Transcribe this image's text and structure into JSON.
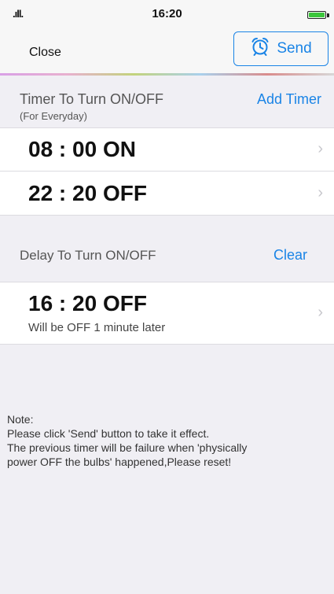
{
  "status": {
    "signal": ".ıll.",
    "time": "16:20",
    "battery_color": "#3cc63c"
  },
  "nav": {
    "close_label": "Close",
    "send_label": "Send",
    "send_icon": "alarm-clock-icon",
    "accent": "#1a84e6"
  },
  "timer_section": {
    "title": "Timer To Turn ON/OFF",
    "subtitle": "(For Everyday)",
    "add_label": "Add Timer",
    "rows": [
      {
        "time": "08 : 00  ON"
      },
      {
        "time": "22 : 20  OFF"
      }
    ]
  },
  "delay_section": {
    "title": "Delay To Turn ON/OFF",
    "clear_label": "Clear",
    "row": {
      "time": "16 : 20  OFF",
      "subtitle": "Will be OFF 1 minute later"
    }
  },
  "note": {
    "lines": [
      "Note:",
      "Please click 'Send' button to take it effect.",
      "The previous timer will be failure when 'physically",
      "power OFF the bulbs' happened,Please reset!"
    ]
  },
  "chevron": "›"
}
